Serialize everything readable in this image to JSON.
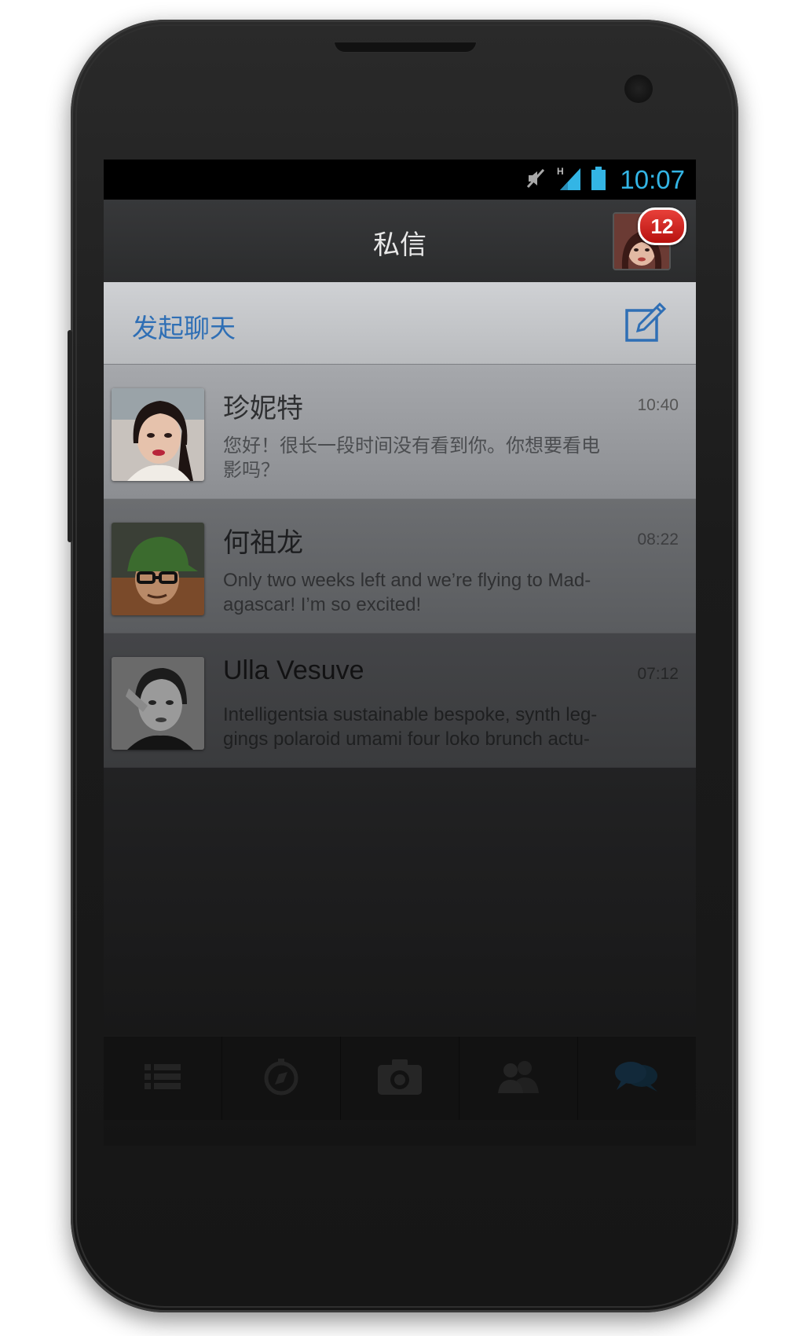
{
  "status_bar": {
    "time": "10:07",
    "network_type": "H",
    "icons": [
      "mute-icon",
      "signal-icon",
      "battery-icon"
    ],
    "accent_color": "#33b5e5"
  },
  "header": {
    "title": "私信",
    "badge_count": "12",
    "badge_color": "#d0201b"
  },
  "compose": {
    "label": "发起聊天",
    "icon": "compose-icon",
    "label_color": "#2f6fb5"
  },
  "conversations": [
    {
      "name": "珍妮特",
      "time": "10:40",
      "preview": "您好！很长一段时间没有看到你。你想要看电影吗？"
    },
    {
      "name": "何祖龙",
      "time": "08:22",
      "preview": "Only two weeks left and we’re flying to Mad-agascar! I’m so excited!"
    },
    {
      "name": "Ulla Vesuve",
      "time": "07:12",
      "preview": "Intelligentsia sustainable bespoke, synth leg-gings polaroid umami four loko brunch actu-"
    }
  ],
  "tabs": [
    {
      "icon": "list-icon"
    },
    {
      "icon": "compass-icon"
    },
    {
      "icon": "camera-icon"
    },
    {
      "icon": "people-icon"
    },
    {
      "icon": "chat-icon",
      "active": true
    }
  ]
}
